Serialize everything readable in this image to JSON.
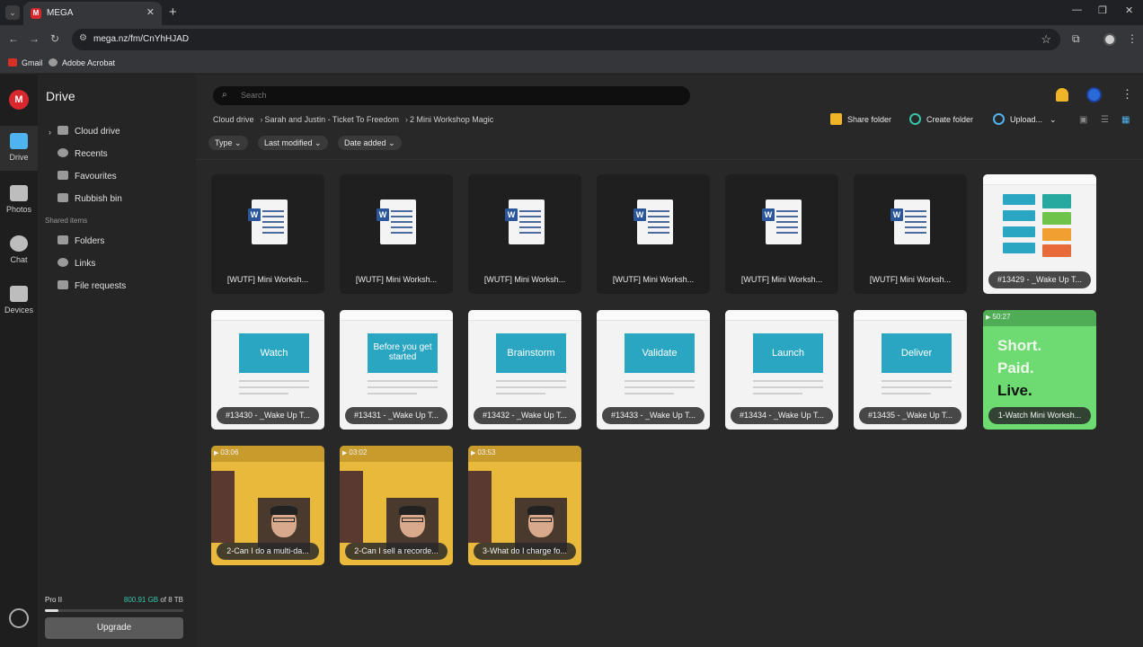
{
  "browser": {
    "tab_title": "MEGA",
    "tab_favicon": "M",
    "url": "mega.nz/fm/CnYhHJAD",
    "bookmarks": [
      "Gmail",
      "Adobe Acrobat"
    ]
  },
  "rail": {
    "logo": "M",
    "items": [
      {
        "label": "Drive",
        "icon": "folder-icon"
      },
      {
        "label": "Photos",
        "icon": "photos-icon"
      },
      {
        "label": "Chat",
        "icon": "chat-icon"
      },
      {
        "label": "Devices",
        "icon": "devices-icon"
      }
    ]
  },
  "sidebar": {
    "title": "Drive",
    "items": [
      "Cloud drive",
      "Recents",
      "Favourites",
      "Rubbish bin"
    ],
    "shared_section": "Shared items",
    "shared_items": [
      "Folders",
      "Links",
      "File requests"
    ],
    "plan": "Pro II",
    "usage_used": "800.91 GB",
    "usage_total": " of 8 TB",
    "usage_fraction": 0.1,
    "upgrade": "Upgrade"
  },
  "search": {
    "placeholder": "Search"
  },
  "breadcrumb": [
    "Cloud drive",
    "Sarah and Justin - Ticket To Freedom",
    "2 Mini Workshop Magic"
  ],
  "actions": {
    "share_folder": "Share folder",
    "create_folder": "Create folder",
    "upload": "Upload..."
  },
  "filters": [
    "Type",
    "Last modified",
    "Date added"
  ],
  "files": {
    "docs": [
      "[WUTF] Mini Worksh...",
      "[WUTF] Mini Worksh...",
      "[WUTF] Mini Worksh...",
      "[WUTF] Mini Worksh...",
      "[WUTF] Mini Worksh...",
      "[WUTF] Mini Worksh..."
    ],
    "first_slide": "#13429 - _Wake Up T...",
    "slides": [
      {
        "banner": "Watch",
        "name": "#13430 - _Wake Up T..."
      },
      {
        "banner": "Before you get started",
        "name": "#13431 - _Wake Up T..."
      },
      {
        "banner": "Brainstorm",
        "name": "#13432 - _Wake Up T..."
      },
      {
        "banner": "Validate",
        "name": "#13433 - _Wake Up T..."
      },
      {
        "banner": "Launch",
        "name": "#13434 - _Wake Up T..."
      },
      {
        "banner": "Deliver",
        "name": "#13435 - _Wake Up T..."
      }
    ],
    "green_video": {
      "duration": "50:27",
      "lines": [
        "Short.",
        "Paid.",
        "Live."
      ],
      "name": "1-Watch Mini Worksh..."
    },
    "videos": [
      {
        "duration": "03:06",
        "name": "2-Can I do a multi-da..."
      },
      {
        "duration": "03:02",
        "name": "2-Can I sell a recorde..."
      },
      {
        "duration": "03:53",
        "name": "3-What do I charge fo..."
      }
    ]
  },
  "colors": {
    "accent_red": "#d9272e",
    "usage_green": "#36c5a8",
    "slide_blue": "#2aa6c3",
    "green_tile": "#6edb72",
    "yellow_tile": "#e8b93a"
  }
}
